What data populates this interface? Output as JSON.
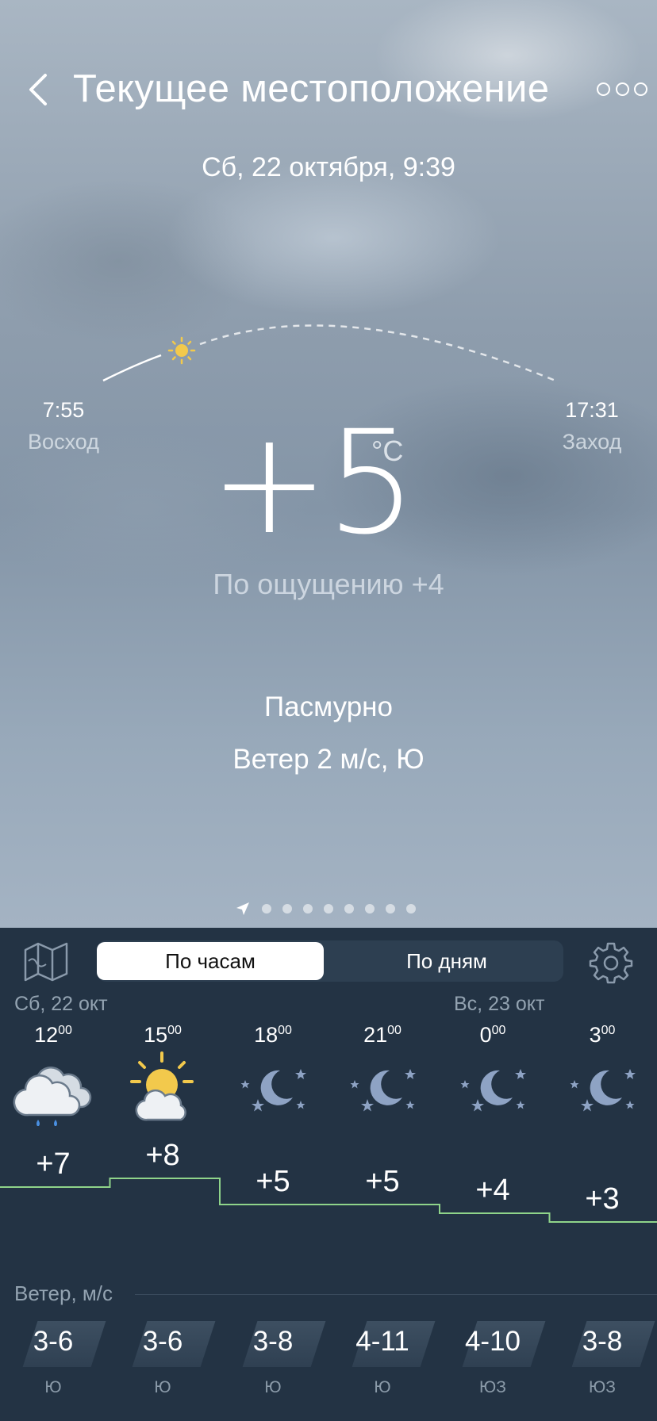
{
  "header": {
    "title": "Текущее местоположение",
    "date": "Сб, 22 октября, 9:39"
  },
  "sun": {
    "sunrise_time": "7:55",
    "sunrise_label": "Восход",
    "sunset_time": "17:31",
    "sunset_label": "Заход"
  },
  "current": {
    "temperature": "+5",
    "unit": "°C",
    "feels_like": "По ощущению +4",
    "condition": "Пасмурно",
    "wind": "Ветер 2 м/с, Ю"
  },
  "pager": {
    "count": 8,
    "active": "location-icon"
  },
  "tabs": {
    "hourly": "По часам",
    "daily": "По дням",
    "active": "hourly"
  },
  "days": [
    "Сб, 22 окт",
    "Вс, 23 окт"
  ],
  "forecast": [
    {
      "hour": "12",
      "minutes": "00",
      "icon": "rain-cloud-icon",
      "temp": "+7",
      "temp_value": 7,
      "wind": "3-6",
      "dir": "Ю"
    },
    {
      "hour": "15",
      "minutes": "00",
      "icon": "sun-cloud-icon",
      "temp": "+8",
      "temp_value": 8,
      "wind": "3-6",
      "dir": "Ю"
    },
    {
      "hour": "18",
      "minutes": "00",
      "icon": "moon-stars-icon",
      "temp": "+5",
      "temp_value": 5,
      "wind": "3-8",
      "dir": "Ю"
    },
    {
      "hour": "21",
      "minutes": "00",
      "icon": "moon-stars-icon",
      "temp": "+5",
      "temp_value": 5,
      "wind": "4-11",
      "dir": "Ю"
    },
    {
      "hour": "0",
      "minutes": "00",
      "icon": "moon-stars-icon",
      "temp": "+4",
      "temp_value": 4,
      "wind": "4-10",
      "dir": "ЮЗ"
    },
    {
      "hour": "3",
      "minutes": "00",
      "icon": "moon-stars-icon",
      "temp": "+3",
      "temp_value": 3,
      "wind": "3-8",
      "dir": "ЮЗ"
    }
  ],
  "wind_header": "Ветер, м/с",
  "colors": {
    "panel": "#233344",
    "temp_line": "#8fd48a",
    "sun": "#f2c94c",
    "moon": "#8ea3c4",
    "rain": "#4a90e2"
  }
}
